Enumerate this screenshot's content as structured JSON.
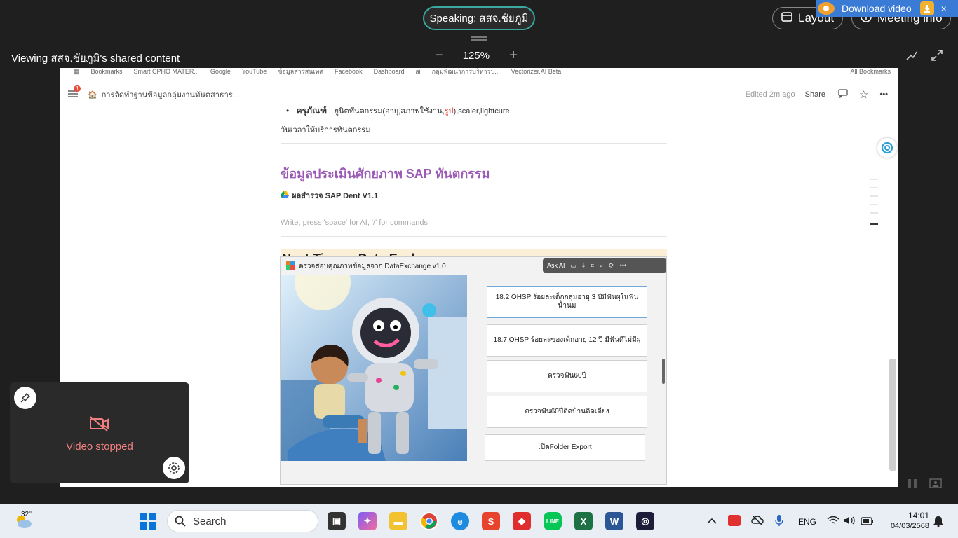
{
  "meeting": {
    "speaking": "Speaking: สสจ.ชัยภูมิ",
    "layout_label": "Layout",
    "meeting_info_label": "Meeting info",
    "viewing": "Viewing สสจ.ชัยภูมิ's shared content",
    "zoom": "125%",
    "zoom_out": "−",
    "zoom_in": "+",
    "download_video": "Download video",
    "close": "×"
  },
  "bookmarks": [
    "Bookmarks",
    "Smart CPHO MATER...",
    "Google",
    "YouTube",
    "ข้อมูลสารสนเทศ",
    "Facebook",
    "Dashboard",
    "ai",
    "กลุ่มพัฒนาการบริหารป...",
    "Vectorizer.AI Beta",
    "All Bookmarks"
  ],
  "doc": {
    "notification_count": "1",
    "breadcrumb": "การจัดทำฐานข้อมูลกลุ่มงานทันตสาธาร...",
    "edited": "Edited 2m ago",
    "share": "Share",
    "bullet_bold": "ครุภัณฑ์",
    "bullet_text_a": "ยูนิตทันตกรรม(อายุ,สภาพใช้งาน,",
    "bullet_red": "รูป",
    "bullet_text_b": "),scaler,lightcure",
    "service_time": "วันเวลาให้บริการทันตกรรม",
    "heading": "ข้อมูลประเมินศักยภาพ SAP ทันตกรรม",
    "drive_link": "ผลสำรวจ SAP Dent V1.1",
    "placeholder": "Write, press 'space' for AI, '/' for commands...",
    "callout": "Next Time→ Data Exchange"
  },
  "app_window": {
    "title": "ตรวจสอบคุณภาพข้อมูลจาก DataExchange v1.0",
    "ask_ai": "Ask AI",
    "buttons": [
      "18.2 OHSP ร้อยละเด็กกลุ่มอายุ 3 ปีมีฟันผุในฟันน้ำนม",
      "18.7 OHSP ร้อยละของเด็กอายุ 12 ปี มีฟันดีไม่มีผุ",
      "ตรวจฟัน60ปี",
      "ตรวจฟัน60ปีติดบ้านติดเตียง",
      "เปิดFolder Export"
    ]
  },
  "video_tile": {
    "label": "Video stopped"
  },
  "taskbar": {
    "temperature": "32°",
    "search": "Search",
    "language": "ENG",
    "time": "14:01",
    "date": "04/03/2568"
  },
  "colors": {
    "accent_teal": "#3aa7a0",
    "heading_purple": "#9b59b6",
    "callout_bg": "#fbefd7",
    "video_stopped_red": "#f08080"
  }
}
